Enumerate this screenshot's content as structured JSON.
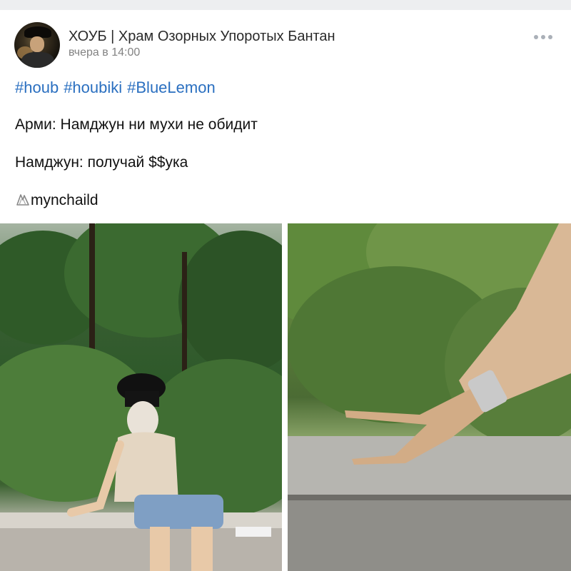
{
  "post": {
    "group_name": "ХОУБ | Храм Озорных Упоротых Бантан",
    "time": "вчера в 14:00",
    "hashtags": [
      "#houb",
      "#houbiki",
      "#BlueLemon"
    ],
    "line1": "Арми: Намджун ни мухи не обидит",
    "line2": "Намджун: получай $$ука",
    "credit": "mynchaild"
  },
  "icons": {
    "more": "more-horizontal-icon",
    "credit": "ghost-hand-icon"
  },
  "colors": {
    "link": "#2a6fc0",
    "meta": "#828282",
    "background": "#ffffff"
  }
}
